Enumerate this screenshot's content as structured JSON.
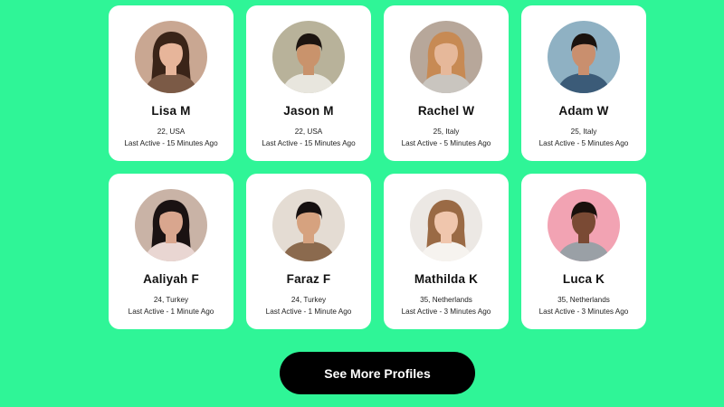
{
  "profiles": [
    {
      "name": "Lisa M",
      "location": "22, USA",
      "last_active": "Last Active - 15 Minutes Ago",
      "avatar_icon": "woman-portrait-icon",
      "bg": "#c9a792",
      "skin": "#e7b59a",
      "hair": "#3a2418",
      "shirt": "#7b5a46"
    },
    {
      "name": "Jason M",
      "location": "22, USA",
      "last_active": "Last Active - 15 Minutes Ago",
      "avatar_icon": "man-portrait-icon",
      "bg": "#b8b29a",
      "skin": "#c9936c",
      "hair": "#1c1410",
      "shirt": "#e8e6de"
    },
    {
      "name": "Rachel W",
      "location": "25, Italy",
      "last_active": "Last Active - 5 Minutes Ago",
      "avatar_icon": "woman-portrait-icon",
      "bg": "#b7a79a",
      "skin": "#e6b89a",
      "hair": "#c78a54",
      "shirt": "#c9c5bf"
    },
    {
      "name": "Adam W",
      "location": "25, Italy",
      "last_active": "Last Active - 5 Minutes Ago",
      "avatar_icon": "man-portrait-icon",
      "bg": "#8fb1c3",
      "skin": "#c98f6e",
      "hair": "#1a120e",
      "shirt": "#3b5b78"
    },
    {
      "name": "Aaliyah F",
      "location": "24, Turkey",
      "last_active": "Last Active - 1 Minute Ago",
      "avatar_icon": "woman-portrait-icon",
      "bg": "#c9b3a6",
      "skin": "#d9a68e",
      "hair": "#1a1212",
      "shirt": "#e9d6d2"
    },
    {
      "name": "Faraz F",
      "location": "24, Turkey",
      "last_active": "Last Active - 1 Minute Ago",
      "avatar_icon": "man-portrait-icon",
      "bg": "#e4dcd3",
      "skin": "#d6a27f",
      "hair": "#161010",
      "shirt": "#8b6a4e"
    },
    {
      "name": "Mathilda K",
      "location": "35, Netherlands",
      "last_active": "Last Active - 3 Minutes Ago",
      "avatar_icon": "woman-portrait-icon",
      "bg": "#ece8e4",
      "skin": "#f0c6ad",
      "hair": "#9a6a45",
      "shirt": "#f6f3ef"
    },
    {
      "name": "Luca K",
      "location": "35, Netherlands",
      "last_active": "Last Active - 3 Minutes Ago",
      "avatar_icon": "man-portrait-icon",
      "bg": "#f2a3b3",
      "skin": "#7a4a34",
      "hair": "#1a100c",
      "shirt": "#9aa0a6"
    }
  ],
  "see_more_label": "See More Profiles",
  "colors": {
    "background": "#2ff597",
    "card": "#ffffff",
    "button": "#000000",
    "button_text": "#ffffff"
  }
}
